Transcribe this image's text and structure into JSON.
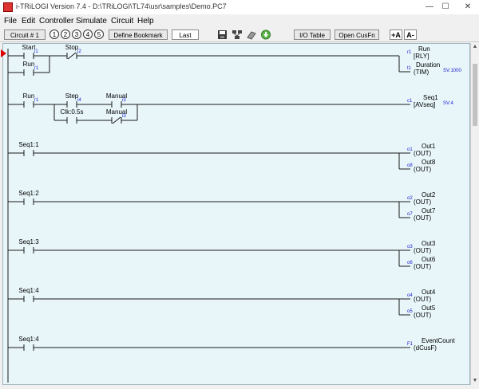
{
  "window": {
    "title": "i-TRiLOGI Version 7.4 - D:\\TRiLOGI\\TL74\\usr\\samples\\Demo.PC7",
    "minimize": "—",
    "maximize": "☐",
    "close": "✕"
  },
  "menu": [
    "File",
    "Edit",
    "Controller",
    "Simulate",
    "Circuit",
    "Help"
  ],
  "toolbar": {
    "circuit": "Circuit # 1",
    "bookmarks": [
      "1",
      "2",
      "3",
      "4",
      "5"
    ],
    "define_bookmark": "Define Bookmark",
    "last": "Last",
    "io_table": "I/O Table",
    "open_cusfn": "Open CusFn",
    "font_up": "+A",
    "font_down": "A-"
  },
  "rungs": [
    {
      "contacts": [
        {
          "name": "Start",
          "index": "i1",
          "type": "NO"
        },
        {
          "name": "Stop",
          "index": "i2",
          "type": "NC"
        },
        {
          "name": "Run",
          "index": "r1",
          "type": "NO"
        }
      ],
      "coils": [
        {
          "name": "Run",
          "index": "r1",
          "kind": "[RLY]",
          "extra": ""
        },
        {
          "name": "Duration",
          "index": "t1",
          "kind": "(TIM)",
          "extra": "SV:1000"
        }
      ]
    },
    {
      "contacts": [
        {
          "name": "Run",
          "index": "r1",
          "type": "NO"
        },
        {
          "name": "Step",
          "index": "i4",
          "type": "NO"
        },
        {
          "name": "Manual",
          "index": "i3",
          "type": "NO"
        },
        {
          "name": "Clk:0.5s",
          "index": "",
          "type": "NO"
        },
        {
          "name": "Manual",
          "index": "i3",
          "type": "NC"
        }
      ],
      "coils": [
        {
          "name": "Seq1",
          "index": "c1",
          "kind": "[AVseq]",
          "extra": "SV:4"
        }
      ]
    },
    {
      "contacts": [
        {
          "name": "Seq1:1",
          "index": "",
          "type": "NO"
        }
      ],
      "coils": [
        {
          "name": "Out1",
          "index": "o1",
          "kind": "(OUT)",
          "extra": ""
        },
        {
          "name": "Out8",
          "index": "o8",
          "kind": "(OUT)",
          "extra": ""
        }
      ]
    },
    {
      "contacts": [
        {
          "name": "Seq1:2",
          "index": "",
          "type": "NO"
        }
      ],
      "coils": [
        {
          "name": "Out2",
          "index": "o2",
          "kind": "(OUT)",
          "extra": ""
        },
        {
          "name": "Out7",
          "index": "o7",
          "kind": "(OUT)",
          "extra": ""
        }
      ]
    },
    {
      "contacts": [
        {
          "name": "Seq1:3",
          "index": "",
          "type": "NO"
        }
      ],
      "coils": [
        {
          "name": "Out3",
          "index": "o3",
          "kind": "(OUT)",
          "extra": ""
        },
        {
          "name": "Out6",
          "index": "o6",
          "kind": "(OUT)",
          "extra": ""
        }
      ]
    },
    {
      "contacts": [
        {
          "name": "Seq1:4",
          "index": "",
          "type": "NO"
        }
      ],
      "coils": [
        {
          "name": "Out4",
          "index": "o4",
          "kind": "(OUT)",
          "extra": ""
        },
        {
          "name": "Out5",
          "index": "o5",
          "kind": "(OUT)",
          "extra": ""
        }
      ]
    },
    {
      "contacts": [
        {
          "name": "Seq1:4",
          "index": "",
          "type": "NO"
        }
      ],
      "coils": [
        {
          "name": "EventCount",
          "index": "F1",
          "kind": "(dCusF)",
          "extra": ""
        }
      ]
    }
  ]
}
